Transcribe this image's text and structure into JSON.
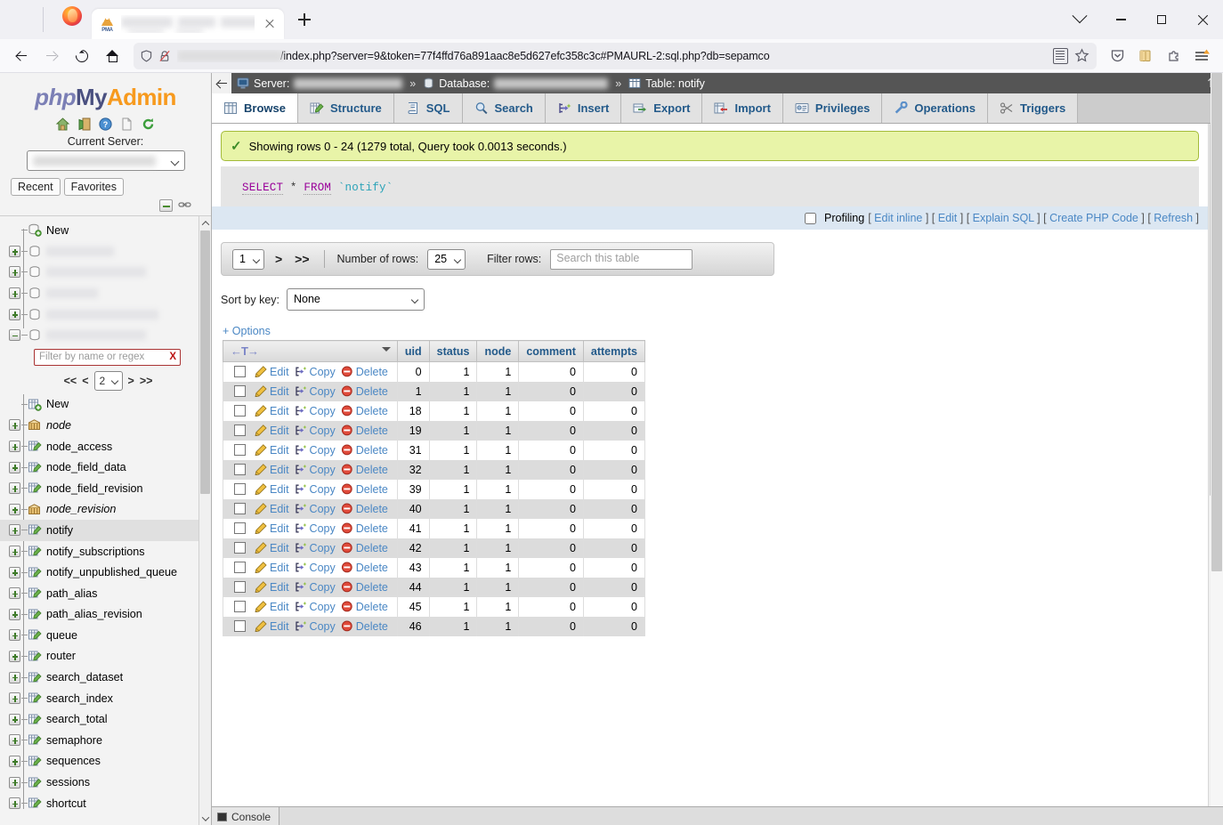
{
  "browser": {
    "tab_title": "",
    "tab_icon": "pma-favicon",
    "url": "/index.php?server=9&token=77f4ffd76a891aac8e5d627efc358c3c#PMAURL-2:sql.php?db=sepamco",
    "new_tab_label": "+",
    "toolbar_icons": [
      "shield-icon",
      "lock-disabled-icon",
      "reader-view-icon",
      "bookmark-star-icon",
      "pocket-icon",
      "library-icon",
      "extensions-icon",
      "app-menu-icon"
    ],
    "nav_icons": [
      "back-arrow",
      "forward-arrow",
      "reload-icon",
      "home-icon"
    ],
    "window_controls": [
      "list-all-tabs",
      "minimize",
      "maximize",
      "close"
    ]
  },
  "sidebar": {
    "logo": {
      "part1": "php",
      "part2": "My",
      "part3": "Admin"
    },
    "icons": [
      "home-icon",
      "logout-icon",
      "docs-icon",
      "blank-page-icon",
      "reload-icon"
    ],
    "current_server_label": "Current Server:",
    "server_value": "",
    "recent_label": "Recent",
    "favorites_label": "Favorites",
    "mini_icons": [
      "collapse-all-icon",
      "link-icon"
    ],
    "new_db_label": "New",
    "databases": [
      "",
      "",
      "",
      "",
      ""
    ],
    "filter_placeholder": "Filter by name or regex",
    "filter_clear": "X",
    "pager": {
      "first": "<<",
      "prev": "<",
      "page": "2",
      "next": ">",
      "last": ">>"
    },
    "new_table_label": "New",
    "tables": [
      {
        "name": "node",
        "type": "view"
      },
      {
        "name": "node_access",
        "type": "table"
      },
      {
        "name": "node_field_data",
        "type": "table"
      },
      {
        "name": "node_field_revision",
        "type": "table"
      },
      {
        "name": "node_revision",
        "type": "view"
      },
      {
        "name": "notify",
        "type": "table",
        "selected": true
      },
      {
        "name": "notify_subscriptions",
        "type": "table"
      },
      {
        "name": "notify_unpublished_queue",
        "type": "table"
      },
      {
        "name": "path_alias",
        "type": "table"
      },
      {
        "name": "path_alias_revision",
        "type": "table"
      },
      {
        "name": "queue",
        "type": "table"
      },
      {
        "name": "router",
        "type": "table"
      },
      {
        "name": "search_dataset",
        "type": "table"
      },
      {
        "name": "search_index",
        "type": "table"
      },
      {
        "name": "search_total",
        "type": "table"
      },
      {
        "name": "semaphore",
        "type": "table"
      },
      {
        "name": "sequences",
        "type": "table"
      },
      {
        "name": "sessions",
        "type": "table"
      },
      {
        "name": "shortcut",
        "type": "table"
      }
    ]
  },
  "breadcrumb": {
    "server_label": "Server:",
    "server_value": "",
    "database_label": "Database:",
    "database_value": "",
    "table_label": "Table: notify",
    "separator": "»"
  },
  "tabs": [
    {
      "label": "Browse",
      "icon": "browse-icon",
      "active": true
    },
    {
      "label": "Structure",
      "icon": "structure-icon",
      "active": false
    },
    {
      "label": "SQL",
      "icon": "sql-icon",
      "active": false
    },
    {
      "label": "Search",
      "icon": "search-icon",
      "active": false
    },
    {
      "label": "Insert",
      "icon": "insert-icon",
      "active": false
    },
    {
      "label": "Export",
      "icon": "export-icon",
      "active": false
    },
    {
      "label": "Import",
      "icon": "import-icon",
      "active": false
    },
    {
      "label": "Privileges",
      "icon": "privileges-icon",
      "active": false
    },
    {
      "label": "Operations",
      "icon": "operations-icon",
      "active": false
    },
    {
      "label": "Triggers",
      "icon": "triggers-icon",
      "active": false
    }
  ],
  "notice": "Showing rows 0 - 24 (1279 total, Query took 0.0013 seconds.)",
  "query": {
    "kw1": "SELECT",
    "star": "*",
    "kw2": "FROM",
    "table": "`notify`"
  },
  "profiling": {
    "label": "Profiling",
    "checked": false,
    "links": [
      "Edit inline",
      "Edit",
      "Explain SQL",
      "Create PHP Code",
      "Refresh"
    ]
  },
  "controls": {
    "page": "1",
    "next": ">",
    "last": ">>",
    "rows_label": "Number of rows:",
    "rows_value": "25",
    "filter_label": "Filter rows:",
    "filter_placeholder": "Search this table",
    "sort_label": "Sort by key:",
    "sort_value": "None",
    "options_label": "+ Options"
  },
  "table": {
    "action_header": "←T→",
    "columns": [
      "uid",
      "status",
      "node",
      "comment",
      "attempts"
    ],
    "row_actions": [
      "Edit",
      "Copy",
      "Delete"
    ],
    "rows": [
      {
        "uid": "0",
        "status": "1",
        "node": "1",
        "comment": "0",
        "attempts": "0"
      },
      {
        "uid": "1",
        "status": "1",
        "node": "1",
        "comment": "0",
        "attempts": "0"
      },
      {
        "uid": "18",
        "status": "1",
        "node": "1",
        "comment": "0",
        "attempts": "0"
      },
      {
        "uid": "19",
        "status": "1",
        "node": "1",
        "comment": "0",
        "attempts": "0"
      },
      {
        "uid": "31",
        "status": "1",
        "node": "1",
        "comment": "0",
        "attempts": "0"
      },
      {
        "uid": "32",
        "status": "1",
        "node": "1",
        "comment": "0",
        "attempts": "0"
      },
      {
        "uid": "39",
        "status": "1",
        "node": "1",
        "comment": "0",
        "attempts": "0"
      },
      {
        "uid": "40",
        "status": "1",
        "node": "1",
        "comment": "0",
        "attempts": "0"
      },
      {
        "uid": "41",
        "status": "1",
        "node": "1",
        "comment": "0",
        "attempts": "0"
      },
      {
        "uid": "42",
        "status": "1",
        "node": "1",
        "comment": "0",
        "attempts": "0"
      },
      {
        "uid": "43",
        "status": "1",
        "node": "1",
        "comment": "0",
        "attempts": "0"
      },
      {
        "uid": "44",
        "status": "1",
        "node": "1",
        "comment": "0",
        "attempts": "0"
      },
      {
        "uid": "45",
        "status": "1",
        "node": "1",
        "comment": "0",
        "attempts": "0"
      },
      {
        "uid": "46",
        "status": "1",
        "node": "1",
        "comment": "0",
        "attempts": "0"
      }
    ]
  },
  "console": {
    "label": "Console"
  },
  "colors": {
    "accent_link": "#4a87c4",
    "tab_text": "#235a8a",
    "notice_bg": "#e8f4a8",
    "notice_border": "#a3bb3a",
    "breadcrumb_bg": "#555555",
    "row_even_bg": "#dcdcdc"
  }
}
